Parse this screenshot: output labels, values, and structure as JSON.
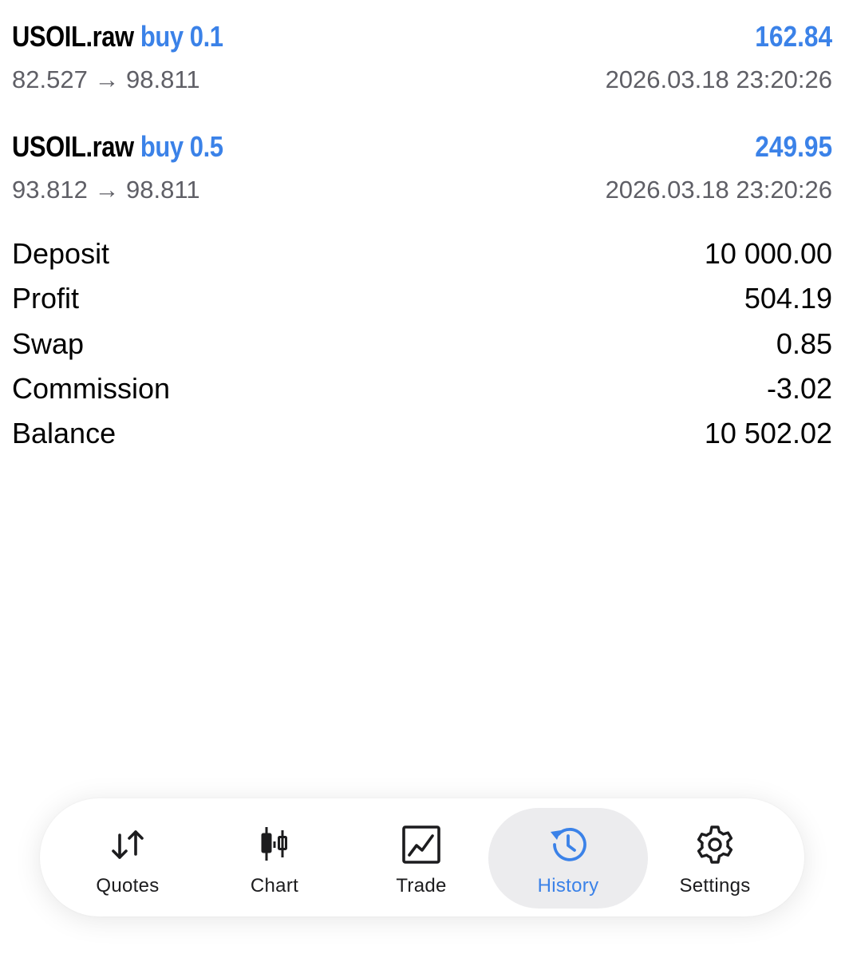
{
  "deals": [
    {
      "symbol": "USOIL.raw",
      "side": "buy 0.1",
      "profit": "162.84",
      "prices": "82.527 → 98.811",
      "time": "2026.03.18 23:20:26"
    },
    {
      "symbol": "USOIL.raw",
      "side": "buy 0.5",
      "profit": "249.95",
      "prices": "93.812 → 98.811",
      "time": "2026.03.18 23:20:26"
    }
  ],
  "summary": [
    {
      "label": "Deposit",
      "value": "10 000.00"
    },
    {
      "label": "Profit",
      "value": "504.19"
    },
    {
      "label": "Swap",
      "value": "0.85"
    },
    {
      "label": "Commission",
      "value": "-3.02"
    },
    {
      "label": "Balance",
      "value": "10 502.02"
    }
  ],
  "tabs": [
    {
      "label": "Quotes",
      "icon": "quotes-arrows-icon"
    },
    {
      "label": "Chart",
      "icon": "candlestick-icon"
    },
    {
      "label": "Trade",
      "icon": "trade-chart-icon"
    },
    {
      "label": "History",
      "icon": "history-clock-icon",
      "active": true
    },
    {
      "label": "Settings",
      "icon": "gear-icon"
    }
  ],
  "colors": {
    "accent": "#3b82e8",
    "secondary_text": "#5f5f66",
    "active_tab_bg": "#ececee"
  }
}
